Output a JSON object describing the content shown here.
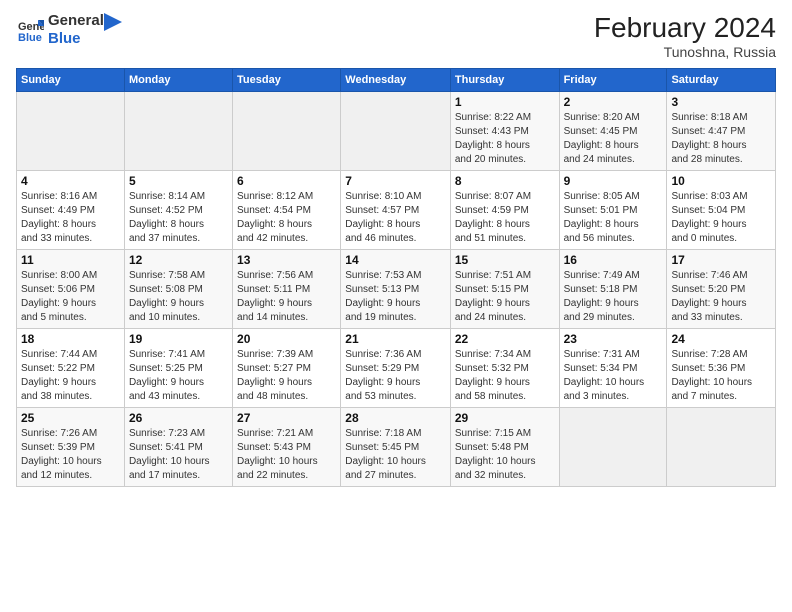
{
  "header": {
    "logo_line1": "General",
    "logo_line2": "Blue",
    "month_year": "February 2024",
    "location": "Tunoshna, Russia"
  },
  "weekdays": [
    "Sunday",
    "Monday",
    "Tuesday",
    "Wednesday",
    "Thursday",
    "Friday",
    "Saturday"
  ],
  "weeks": [
    [
      {
        "day": "",
        "info": ""
      },
      {
        "day": "",
        "info": ""
      },
      {
        "day": "",
        "info": ""
      },
      {
        "day": "",
        "info": ""
      },
      {
        "day": "1",
        "info": "Sunrise: 8:22 AM\nSunset: 4:43 PM\nDaylight: 8 hours\nand 20 minutes."
      },
      {
        "day": "2",
        "info": "Sunrise: 8:20 AM\nSunset: 4:45 PM\nDaylight: 8 hours\nand 24 minutes."
      },
      {
        "day": "3",
        "info": "Sunrise: 8:18 AM\nSunset: 4:47 PM\nDaylight: 8 hours\nand 28 minutes."
      }
    ],
    [
      {
        "day": "4",
        "info": "Sunrise: 8:16 AM\nSunset: 4:49 PM\nDaylight: 8 hours\nand 33 minutes."
      },
      {
        "day": "5",
        "info": "Sunrise: 8:14 AM\nSunset: 4:52 PM\nDaylight: 8 hours\nand 37 minutes."
      },
      {
        "day": "6",
        "info": "Sunrise: 8:12 AM\nSunset: 4:54 PM\nDaylight: 8 hours\nand 42 minutes."
      },
      {
        "day": "7",
        "info": "Sunrise: 8:10 AM\nSunset: 4:57 PM\nDaylight: 8 hours\nand 46 minutes."
      },
      {
        "day": "8",
        "info": "Sunrise: 8:07 AM\nSunset: 4:59 PM\nDaylight: 8 hours\nand 51 minutes."
      },
      {
        "day": "9",
        "info": "Sunrise: 8:05 AM\nSunset: 5:01 PM\nDaylight: 8 hours\nand 56 minutes."
      },
      {
        "day": "10",
        "info": "Sunrise: 8:03 AM\nSunset: 5:04 PM\nDaylight: 9 hours\nand 0 minutes."
      }
    ],
    [
      {
        "day": "11",
        "info": "Sunrise: 8:00 AM\nSunset: 5:06 PM\nDaylight: 9 hours\nand 5 minutes."
      },
      {
        "day": "12",
        "info": "Sunrise: 7:58 AM\nSunset: 5:08 PM\nDaylight: 9 hours\nand 10 minutes."
      },
      {
        "day": "13",
        "info": "Sunrise: 7:56 AM\nSunset: 5:11 PM\nDaylight: 9 hours\nand 14 minutes."
      },
      {
        "day": "14",
        "info": "Sunrise: 7:53 AM\nSunset: 5:13 PM\nDaylight: 9 hours\nand 19 minutes."
      },
      {
        "day": "15",
        "info": "Sunrise: 7:51 AM\nSunset: 5:15 PM\nDaylight: 9 hours\nand 24 minutes."
      },
      {
        "day": "16",
        "info": "Sunrise: 7:49 AM\nSunset: 5:18 PM\nDaylight: 9 hours\nand 29 minutes."
      },
      {
        "day": "17",
        "info": "Sunrise: 7:46 AM\nSunset: 5:20 PM\nDaylight: 9 hours\nand 33 minutes."
      }
    ],
    [
      {
        "day": "18",
        "info": "Sunrise: 7:44 AM\nSunset: 5:22 PM\nDaylight: 9 hours\nand 38 minutes."
      },
      {
        "day": "19",
        "info": "Sunrise: 7:41 AM\nSunset: 5:25 PM\nDaylight: 9 hours\nand 43 minutes."
      },
      {
        "day": "20",
        "info": "Sunrise: 7:39 AM\nSunset: 5:27 PM\nDaylight: 9 hours\nand 48 minutes."
      },
      {
        "day": "21",
        "info": "Sunrise: 7:36 AM\nSunset: 5:29 PM\nDaylight: 9 hours\nand 53 minutes."
      },
      {
        "day": "22",
        "info": "Sunrise: 7:34 AM\nSunset: 5:32 PM\nDaylight: 9 hours\nand 58 minutes."
      },
      {
        "day": "23",
        "info": "Sunrise: 7:31 AM\nSunset: 5:34 PM\nDaylight: 10 hours\nand 3 minutes."
      },
      {
        "day": "24",
        "info": "Sunrise: 7:28 AM\nSunset: 5:36 PM\nDaylight: 10 hours\nand 7 minutes."
      }
    ],
    [
      {
        "day": "25",
        "info": "Sunrise: 7:26 AM\nSunset: 5:39 PM\nDaylight: 10 hours\nand 12 minutes."
      },
      {
        "day": "26",
        "info": "Sunrise: 7:23 AM\nSunset: 5:41 PM\nDaylight: 10 hours\nand 17 minutes."
      },
      {
        "day": "27",
        "info": "Sunrise: 7:21 AM\nSunset: 5:43 PM\nDaylight: 10 hours\nand 22 minutes."
      },
      {
        "day": "28",
        "info": "Sunrise: 7:18 AM\nSunset: 5:45 PM\nDaylight: 10 hours\nand 27 minutes."
      },
      {
        "day": "29",
        "info": "Sunrise: 7:15 AM\nSunset: 5:48 PM\nDaylight: 10 hours\nand 32 minutes."
      },
      {
        "day": "",
        "info": ""
      },
      {
        "day": "",
        "info": ""
      }
    ]
  ]
}
